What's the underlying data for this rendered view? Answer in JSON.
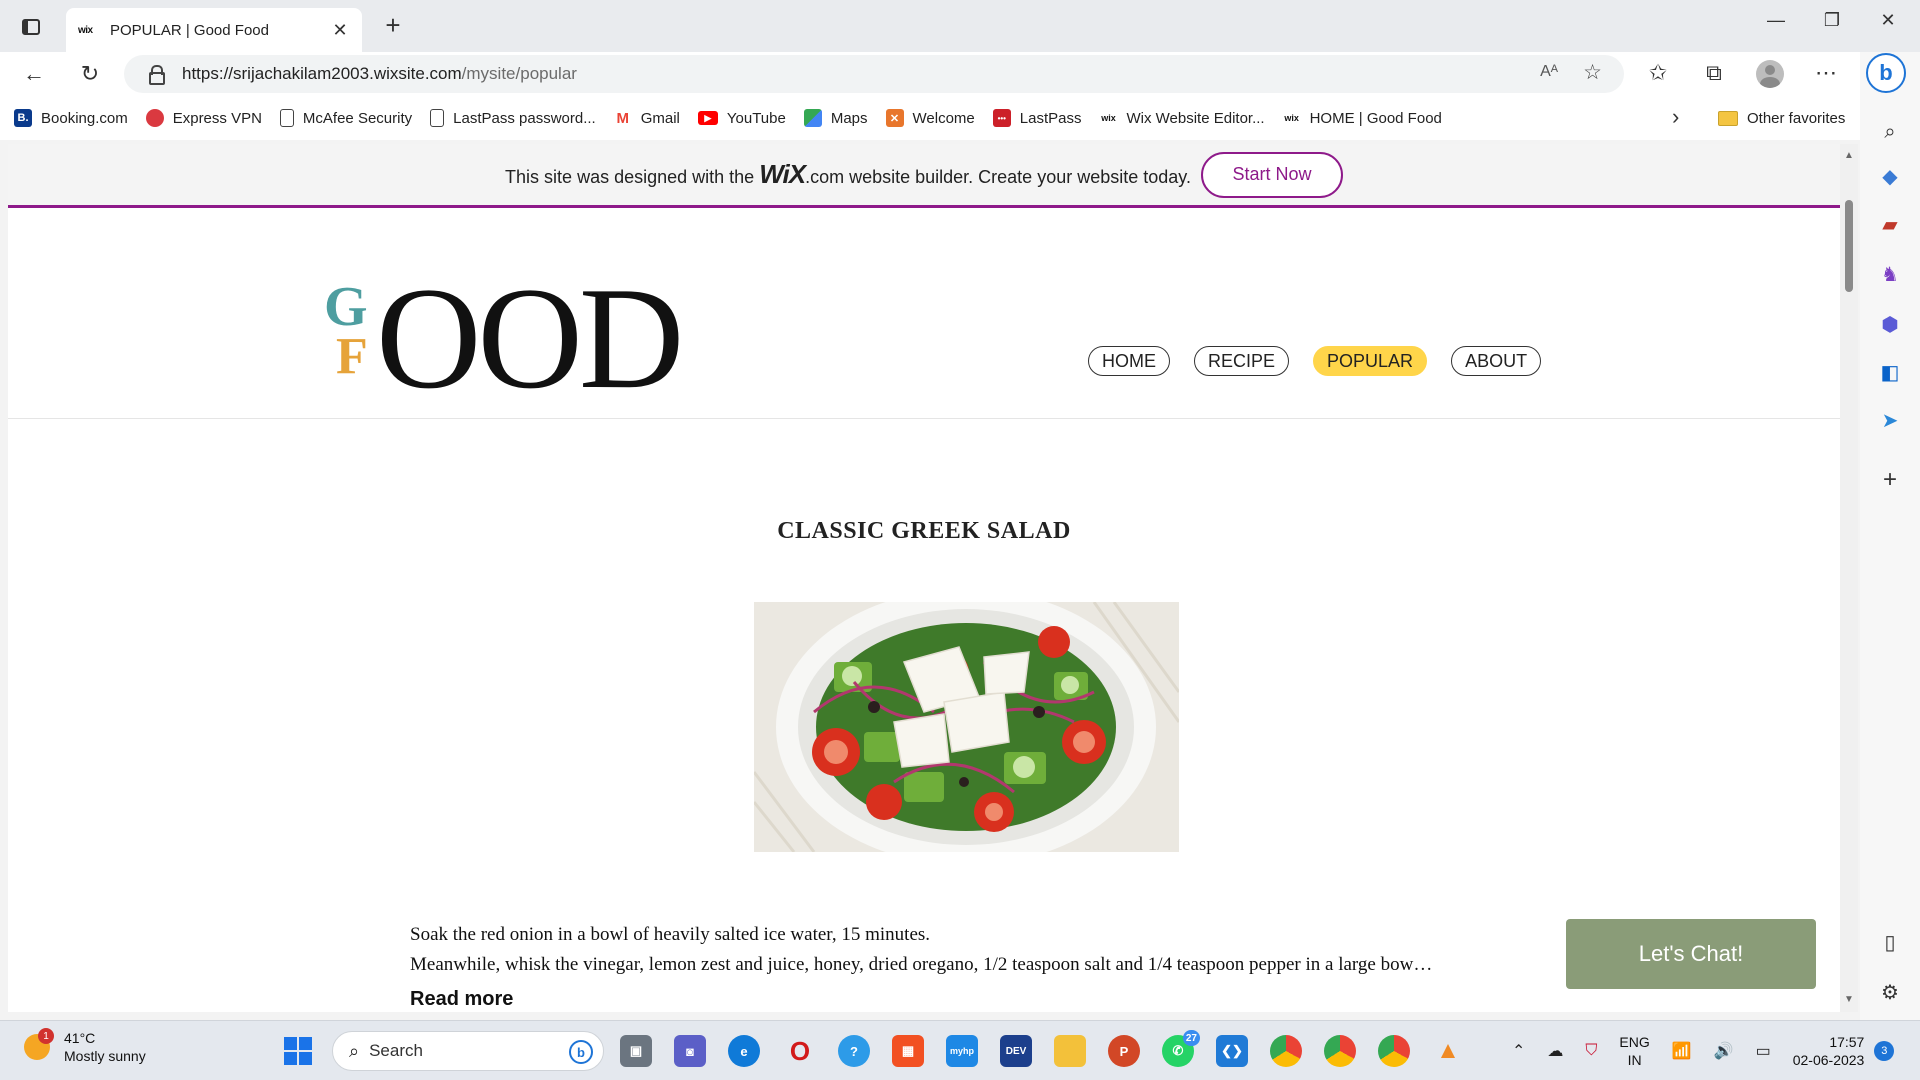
{
  "browser": {
    "tab": {
      "favicon": "wix",
      "title": "POPULAR | Good Food"
    },
    "url": {
      "host": "https://srijachakilam2003.wixsite.com",
      "path": "/mysite/popular",
      "read_aloud": "Aᴬ"
    },
    "bookmarks": [
      {
        "label": "Booking.com",
        "icon": "booking-icon",
        "color": "#0a3a8c",
        "glyph": "B."
      },
      {
        "label": "Express VPN",
        "icon": "expressvpn-icon",
        "color": "#da3940",
        "glyph": ""
      },
      {
        "label": "McAfee Security",
        "icon": "page-icon",
        "color": "",
        "glyph": ""
      },
      {
        "label": "LastPass password...",
        "icon": "page-icon",
        "color": "",
        "glyph": ""
      },
      {
        "label": "Gmail",
        "icon": "gmail-icon",
        "color": "#ea4335",
        "glyph": "M"
      },
      {
        "label": "YouTube",
        "icon": "youtube-icon",
        "color": "#ff0000",
        "glyph": "▶"
      },
      {
        "label": "Maps",
        "icon": "maps-icon",
        "color": "#34a853",
        "glyph": ""
      },
      {
        "label": "Welcome",
        "icon": "welcome-icon",
        "color": "#e8762c",
        "glyph": ""
      },
      {
        "label": "LastPass",
        "icon": "lastpass-icon",
        "color": "#cc2029",
        "glyph": "•••"
      },
      {
        "label": "Wix Website Editor...",
        "icon": "wix-icon",
        "color": "",
        "glyph": "wix"
      },
      {
        "label": "HOME | Good Food",
        "icon": "wix-icon",
        "color": "",
        "glyph": "wix"
      }
    ],
    "other_favorites": "Other favorites"
  },
  "page": {
    "banner": {
      "prefix": "This site was designed with the ",
      "wix": "WiX",
      "com": ".com",
      "suffix": " website builder. Create your website today.",
      "button": "Start Now"
    },
    "logo": {
      "g": "G",
      "f": "F",
      "ood": "OOD"
    },
    "nav": [
      {
        "label": "HOME",
        "active": false
      },
      {
        "label": "RECIPE",
        "active": false
      },
      {
        "label": "POPULAR",
        "active": true
      },
      {
        "label": "ABOUT",
        "active": false
      }
    ],
    "post": {
      "title": "CLASSIC GREEK SALAD",
      "line1": "Soak the red onion in a bowl of heavily salted ice water, 15 minutes.",
      "line2": "Meanwhile, whisk the vinegar, lemon zest and juice, honey, dried oregano, 1/2 teaspoon salt and 1/4 teaspoon pepper in a large bow…",
      "read_more": "Read more"
    },
    "chat": "Let's Chat!"
  },
  "taskbar": {
    "weather": {
      "temp": "41°C",
      "desc": "Mostly sunny",
      "badge": "1"
    },
    "search": "Search",
    "badges": {
      "whatsapp": "27"
    },
    "tray": {
      "lang1": "ENG",
      "lang2": "IN",
      "time": "17:57",
      "date": "02-06-2023",
      "notifications": "3"
    }
  }
}
